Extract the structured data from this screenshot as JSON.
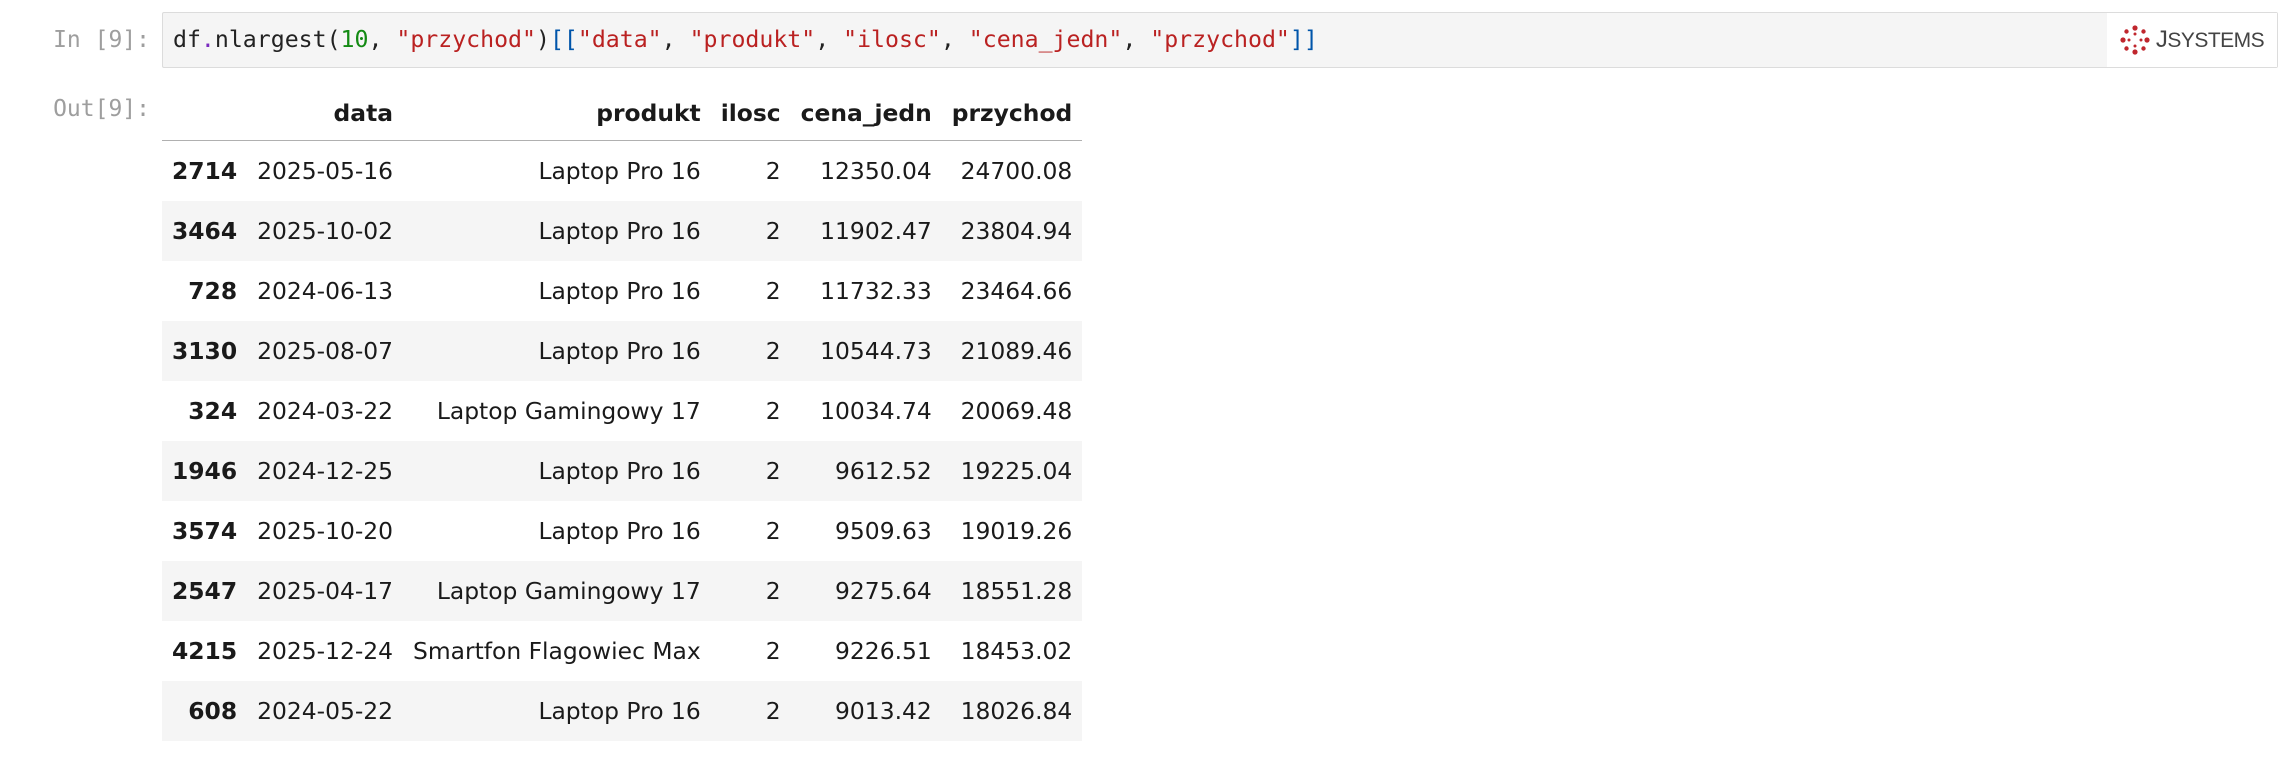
{
  "cell": {
    "in_prompt": "In [9]:",
    "out_prompt": "Out[9]:",
    "code": {
      "var": "df",
      "dot": ".",
      "method": "nlargest(",
      "arg_num": "10",
      "sep1": ", ",
      "arg_str": "\"przychod\"",
      "close_paren": ")",
      "open_brackets": "[[",
      "col1": "\"data\"",
      "c1": ", ",
      "col2": "\"produkt\"",
      "c2": ", ",
      "col3": "\"ilosc\"",
      "c3": ", ",
      "col4": "\"cena_jedn\"",
      "c4": ", ",
      "col5": "\"przychod\"",
      "close_brackets": "]]"
    }
  },
  "logo": {
    "text_j": "J",
    "text_rest": "SYSTEMS",
    "brand_color": "#c0262d"
  },
  "table": {
    "columns": [
      "",
      "data",
      "produkt",
      "ilosc",
      "cena_jedn",
      "przychod"
    ],
    "rows": [
      [
        "2714",
        "2025-05-16",
        "Laptop Pro 16",
        "2",
        "12350.04",
        "24700.08"
      ],
      [
        "3464",
        "2025-10-02",
        "Laptop Pro 16",
        "2",
        "11902.47",
        "23804.94"
      ],
      [
        "728",
        "2024-06-13",
        "Laptop Pro 16",
        "2",
        "11732.33",
        "23464.66"
      ],
      [
        "3130",
        "2025-08-07",
        "Laptop Pro 16",
        "2",
        "10544.73",
        "21089.46"
      ],
      [
        "324",
        "2024-03-22",
        "Laptop Gamingowy 17",
        "2",
        "10034.74",
        "20069.48"
      ],
      [
        "1946",
        "2024-12-25",
        "Laptop Pro 16",
        "2",
        "9612.52",
        "19225.04"
      ],
      [
        "3574",
        "2025-10-20",
        "Laptop Pro 16",
        "2",
        "9509.63",
        "19019.26"
      ],
      [
        "2547",
        "2025-04-17",
        "Laptop Gamingowy 17",
        "2",
        "9275.64",
        "18551.28"
      ],
      [
        "4215",
        "2025-12-24",
        "Smartfon Flagowiec Max",
        "2",
        "9226.51",
        "18453.02"
      ],
      [
        "608",
        "2024-05-22",
        "Laptop Pro 16",
        "2",
        "9013.42",
        "18026.84"
      ]
    ]
  }
}
